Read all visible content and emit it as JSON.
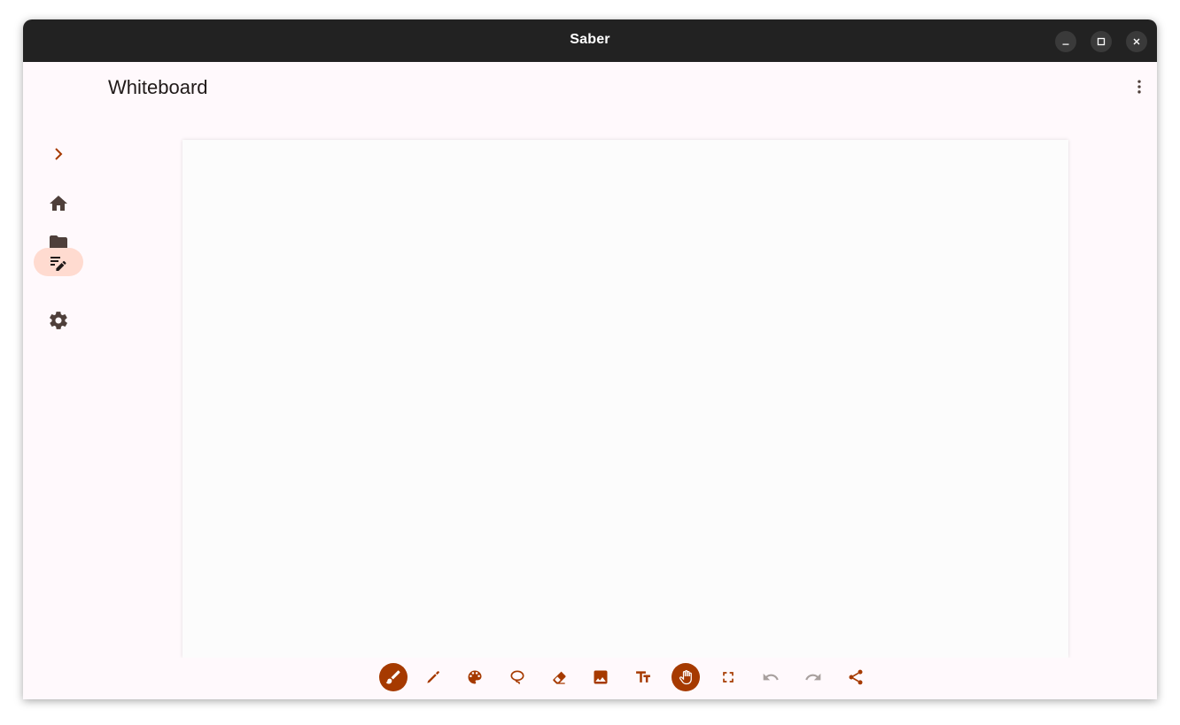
{
  "window": {
    "title": "Saber",
    "buttons": [
      "minimize-icon",
      "maximize-icon",
      "close-icon"
    ]
  },
  "header": {
    "title": "Whiteboard",
    "menu_icon": "more-vert-icon"
  },
  "rail": {
    "expand_icon": "chevron-right-icon",
    "items": [
      {
        "icon": "home-icon",
        "active": false
      },
      {
        "icon": "folder-icon",
        "active": false
      },
      {
        "icon": "edit-note-icon",
        "active": true
      },
      {
        "icon": "settings-icon",
        "active": false
      }
    ]
  },
  "toolbar": {
    "tools": [
      {
        "icon": "brush-icon",
        "active": true
      },
      {
        "icon": "highlighter-icon",
        "active": false
      },
      {
        "icon": "palette-icon",
        "active": false
      },
      {
        "icon": "lasso-icon",
        "active": false
      },
      {
        "icon": "eraser-icon",
        "active": false
      },
      {
        "icon": "image-icon",
        "active": false
      },
      {
        "icon": "text-size-icon",
        "active": false
      },
      {
        "icon": "hand-pan-icon",
        "active": true
      },
      {
        "icon": "fullscreen-icon",
        "active": false
      },
      {
        "icon": "undo-icon",
        "active": false,
        "disabled": true
      },
      {
        "icon": "redo-icon",
        "active": false,
        "disabled": true
      },
      {
        "icon": "share-icon",
        "active": false
      }
    ]
  },
  "colors": {
    "accent": "#a63a00",
    "rail_icon": "#4e3f3a",
    "active_pill": "#ffdbd0",
    "disabled": "#a8a09e",
    "background": "#fff9fc",
    "canvas": "#fcfcfc",
    "titlebar": "#222222"
  }
}
